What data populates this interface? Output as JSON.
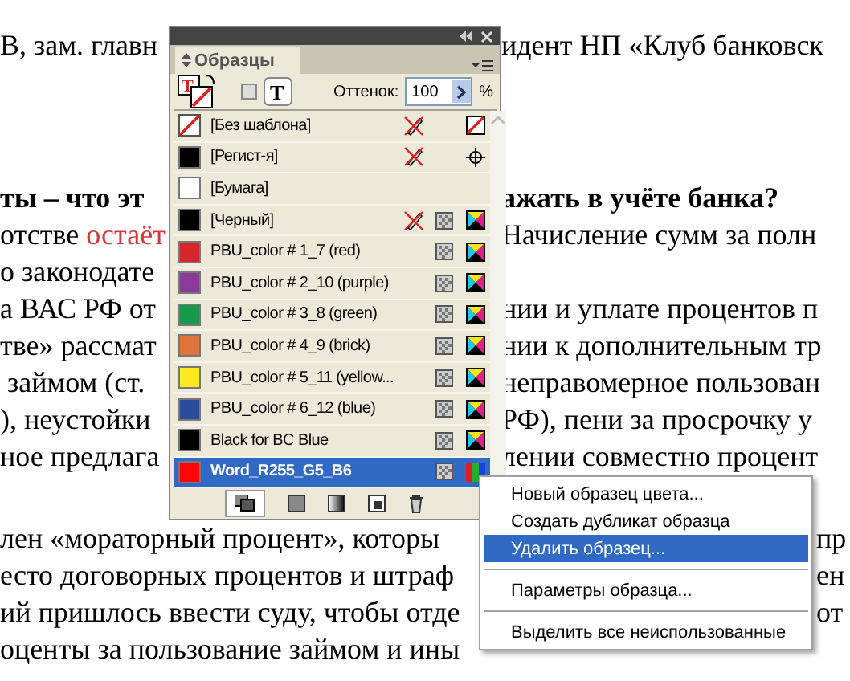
{
  "document": {
    "lines": [
      {
        "kind": "top",
        "left": "В, зам. главн",
        "right": "идент НП «Клуб банковск"
      },
      {
        "kind": "heading",
        "left": "ты – что эт",
        "right": "ажать в учёте банка?"
      },
      {
        "kind": "panel",
        "left": "отстве ",
        "left_red": "остаёт",
        "right": "Начисление сумм за полн"
      },
      {
        "kind": "panel",
        "left": "о законодате"
      },
      {
        "kind": "panel",
        "left": "а ВАС РФ от",
        "right": "нии и уплате процентов п"
      },
      {
        "kind": "panel",
        "left": "тве» рассмат",
        "right": "нии к дополнительным тр"
      },
      {
        "kind": "panel",
        "left": " займом (ст.",
        "right": "неправомерное пользован"
      },
      {
        "kind": "panel",
        "left": "), неустойки",
        "right": "РФ), пени за просрочку у"
      },
      {
        "kind": "panel",
        "left": "ное предлага",
        "right": "лении совместно процент"
      },
      {
        "kind": "para",
        "left": "лен «мораторный процент», которы",
        "right": "пр"
      },
      {
        "kind": "menu",
        "left": "есто договорных процентов и штраф",
        "right": "ен"
      },
      {
        "kind": "menu",
        "left": "ий пришлось ввести суду, чтобы отде",
        "right": "от"
      },
      {
        "kind": "menu",
        "left": "оценты за пользование займом и ины"
      }
    ]
  },
  "panel": {
    "tab": "Образцы",
    "fill_letter": "T",
    "text_letter": "T",
    "tint_label": "Оттенок:",
    "tint_value": "100",
    "percent": "%",
    "swatches": [
      {
        "name": "[Без шаблона]",
        "kind": "none",
        "color": "#ffffff",
        "locked": true,
        "selected": false
      },
      {
        "name": "[Регист-я]",
        "kind": "registration",
        "color": "#000000",
        "locked": true,
        "selected": false
      },
      {
        "name": "[Бумага]",
        "kind": "paper",
        "color": "#ffffff",
        "locked": false,
        "selected": false
      },
      {
        "name": "[Черный]",
        "kind": "cmyk",
        "color": "#000000",
        "locked": true,
        "selected": false
      },
      {
        "name": "PBU_color # 1_7 (red)",
        "kind": "cmyk",
        "color": "#d7262b",
        "locked": false,
        "selected": false
      },
      {
        "name": "PBU_color # 2_10 (purple)",
        "kind": "cmyk",
        "color": "#8a3a97",
        "locked": false,
        "selected": false
      },
      {
        "name": "PBU_color # 3_8 (green)",
        "kind": "cmyk",
        "color": "#179a4a",
        "locked": false,
        "selected": false
      },
      {
        "name": "PBU_color # 4_9 (brick)",
        "kind": "cmyk",
        "color": "#e2733a",
        "locked": false,
        "selected": false
      },
      {
        "name": "PBU_color # 5_11 (yellow...",
        "kind": "cmyk",
        "color": "#fde91f",
        "locked": false,
        "selected": false
      },
      {
        "name": "PBU_color # 6_12 (blue)",
        "kind": "cmyk",
        "color": "#2a4c9c",
        "locked": false,
        "selected": false
      },
      {
        "name": "Black for BC Blue",
        "kind": "cmyk",
        "color": "#000000",
        "locked": false,
        "selected": false
      },
      {
        "name": "Word_R255_G5_B6",
        "kind": "rgb",
        "color": "#ff0506",
        "locked": false,
        "selected": true
      }
    ]
  },
  "context_menu": {
    "items": [
      {
        "kind": "item",
        "label": "Новый образец цвета...",
        "selected": false
      },
      {
        "kind": "item",
        "label": "Создать дубликат образца",
        "selected": false
      },
      {
        "kind": "item",
        "label": "Удалить образец...",
        "selected": true
      },
      {
        "kind": "separator"
      },
      {
        "kind": "item",
        "label": "Параметры образца...",
        "selected": false
      },
      {
        "kind": "separator"
      },
      {
        "kind": "item",
        "label": "Выделить все неиспользованные",
        "selected": false
      }
    ]
  }
}
